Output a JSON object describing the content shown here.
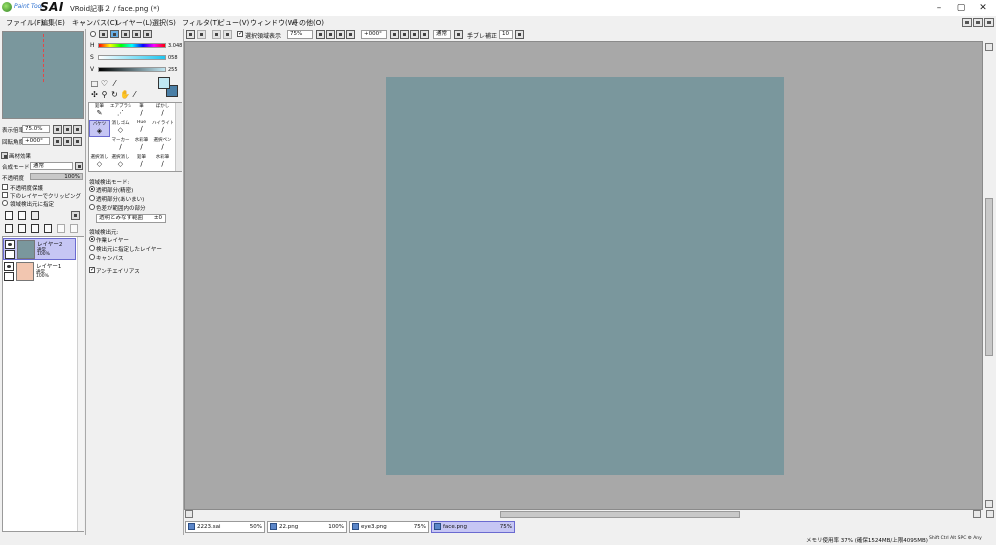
{
  "window": {
    "brand_small": "Paint Tool",
    "brand_big": "SAI",
    "title": "VRoid記事２ / face.png (*)",
    "controls": [
      "–",
      "▢",
      "✕"
    ]
  },
  "menu": [
    "ファイル(F)",
    "編集(E)",
    "キャンバス(C)",
    "レイヤー(L)",
    "選択(S)",
    "フィルタ(T)",
    "ビュー(V)",
    "ウィンドウ(W)",
    "その他(O)"
  ],
  "navigator": {
    "zoom_label": "表示倍率",
    "zoom_value": "75.0%",
    "angle_label": "回転角度",
    "angle_value": "+000°"
  },
  "layer_panel": {
    "effects_label": "画材効果",
    "blend_label": "合成モード",
    "blend_value": "通常",
    "opacity_label": "不透明度",
    "opacity_value": "100%",
    "options": [
      "不透明度保護",
      "下のレイヤーでクリッピング",
      "領域検出元に指定"
    ],
    "layers": [
      {
        "name": "レイヤー2",
        "mode": "通常",
        "opacity": "100%",
        "thumb_color": "#7a979d",
        "selected": true
      },
      {
        "name": "レイヤー1",
        "mode": "通常",
        "opacity": "100%",
        "thumb_color": "#f2c6b0",
        "selected": false
      }
    ]
  },
  "color": {
    "h_label": "H",
    "h_value": "3.048",
    "s_label": "S",
    "s_value": "058",
    "v_label": "V",
    "v_value": "255",
    "primary": "#bfe6f2",
    "secondary": "#4a7fa6"
  },
  "brushes": [
    {
      "name": "鉛筆",
      "icon": "✎"
    },
    {
      "name": "エアブラシ",
      "icon": "⋰"
    },
    {
      "name": "筆",
      "icon": "∕"
    },
    {
      "name": "ぼかし",
      "icon": "∕"
    },
    {
      "name": "バケツ",
      "icon": "◈"
    },
    {
      "name": "消しゴム",
      "icon": "◇"
    },
    {
      "name": "Hue",
      "icon": "∕"
    },
    {
      "name": "ハイライト",
      "icon": "∕"
    },
    {
      "name": "",
      "icon": ""
    },
    {
      "name": "マーカー",
      "icon": "∕"
    },
    {
      "name": "水彩筆",
      "icon": "∕"
    },
    {
      "name": "選択ペン",
      "icon": "∕"
    },
    {
      "name": "選択消し",
      "icon": "◇"
    },
    {
      "name": "選択消し",
      "icon": "◇"
    },
    {
      "name": "鉛筆",
      "icon": "∕"
    },
    {
      "name": "水彩筆",
      "icon": "∕"
    }
  ],
  "fill_options": {
    "detect_mode_label": "領域検出モード:",
    "detect_modes": [
      "透明部分(精密)",
      "透明部分(あいまい)",
      "色差が範囲内の部分"
    ],
    "range_label": "透明とみなす範囲",
    "range_value": "±0",
    "source_label": "領域検出元:",
    "sources": [
      "作業レイヤー",
      "検出元に指定したレイヤー",
      "キャンバス"
    ],
    "antialias_label": "アンチエイリアス"
  },
  "toolbar": {
    "show_selection_label": "選択領域表示",
    "zoom": "75%",
    "angle": "+000°",
    "blend": "通常",
    "stabilizer_label": "手ブレ補正",
    "stabilizer_value": "10"
  },
  "tabs": [
    {
      "name": "2223.sai",
      "zoom": "50%"
    },
    {
      "name": "22.png",
      "zoom": "100%"
    },
    {
      "name": "eye3.png",
      "zoom": "75%"
    },
    {
      "name": "face.png",
      "zoom": "75%"
    }
  ],
  "status": {
    "memory": "メモリ使用率 37% (確保1524MB/上限4095MB)",
    "keys": "Shift Ctrl Alt SPC ⚙ Any"
  },
  "colors": {
    "canvas": "#7a979d",
    "workspace": "#a8a8a8",
    "selection": "#c6c6f4"
  }
}
